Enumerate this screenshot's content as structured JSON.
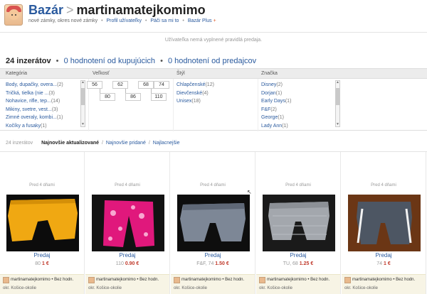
{
  "header": {
    "section": "Bazár",
    "separator": ">",
    "username": "martinamatejkomimo",
    "location": "nové zámky, okres nové zámky",
    "links": [
      "Profil užívateľky",
      "Páči sa mi to",
      "Bazár Plus"
    ],
    "plus_mark": "+"
  },
  "notice": "Užívateľka nemá vyplnené pravidlá predaja.",
  "stats": {
    "count": "24 inzerátov",
    "buyers": "0 hodnotení od kupujúcich",
    "sellers": "0 hodnotení od predajcov"
  },
  "filters": {
    "headers": [
      "Kategória",
      "Veľkosť",
      "Štýl",
      "Značka"
    ],
    "category": [
      {
        "label": "Body, dupačky, overa...",
        "count": "(2)"
      },
      {
        "label": "Tričká, tielka (nie ...",
        "count": "(3)"
      },
      {
        "label": "Nohavice, rifle, tep...",
        "count": "(14)"
      },
      {
        "label": "Mikiny, svetre, vest...",
        "count": "(3)"
      },
      {
        "label": "Zimné overaly, kombi...",
        "count": "(1)"
      },
      {
        "label": "Kočíky a fusaky",
        "count": "(1)"
      }
    ],
    "sizes_top": [
      "56",
      "62",
      "68",
      "74"
    ],
    "sizes_bottom": [
      "80",
      "86",
      "110"
    ],
    "style": [
      {
        "label": "Chlapčenské",
        "count": "(12)"
      },
      {
        "label": "Dievčenské",
        "count": "(4)"
      },
      {
        "label": "Unisex",
        "count": "(18)"
      }
    ],
    "brand": [
      {
        "label": "Disney",
        "count": "(2)"
      },
      {
        "label": "Dorjan",
        "count": "(1)"
      },
      {
        "label": "Early Days",
        "count": "(1)"
      },
      {
        "label": "F&F",
        "count": "(2)"
      },
      {
        "label": "George",
        "count": "(1)"
      },
      {
        "label": "Lady Ann",
        "count": "(1)"
      }
    ]
  },
  "sort": {
    "count": "24 inzerátov",
    "active": "Najnovšie aktualizované",
    "options": [
      "Najnovšie pridané",
      "Najlacnejšie"
    ],
    "divider": "/"
  },
  "listings": [
    {
      "when": "Pred 4 dňami",
      "kind": "Predaj",
      "size": "80",
      "price": "1 €",
      "photo": "yellow-pants",
      "seller": "martinamatejkomimo • Bez hodn.",
      "location": "okr. Košice-okolie"
    },
    {
      "when": "Pred 4 dňami",
      "kind": "Predaj",
      "size": "110",
      "price": "0.90 €",
      "photo": "pink-leggings",
      "seller": "martinamatejkomimo • Bez hodn.",
      "location": "okr. Košice-okolie"
    },
    {
      "when": "Pred 4 dňami",
      "kind": "Predaj",
      "size": "F&F, 74",
      "price": "1.50 €",
      "photo": "grey-pants",
      "seller": "martinamatejkomimo • Bez hodn.",
      "location": "okr. Košice-okolie"
    },
    {
      "when": "Pred 4 dňami",
      "kind": "Predaj",
      "size": "TU, 68",
      "price": "1.25 €",
      "photo": "grey-check-pants",
      "seller": "martinamatejkomimo • Bez hodn.",
      "location": "okr. Košice-okolie"
    },
    {
      "when": "Pred 4 dňami",
      "kind": "Predaj",
      "size": "74",
      "price": "1 €",
      "photo": "tracksuit-pants",
      "seller": "martinamatejkomimo • Bez hodn.",
      "location": "okr. Košice-okolie"
    }
  ]
}
